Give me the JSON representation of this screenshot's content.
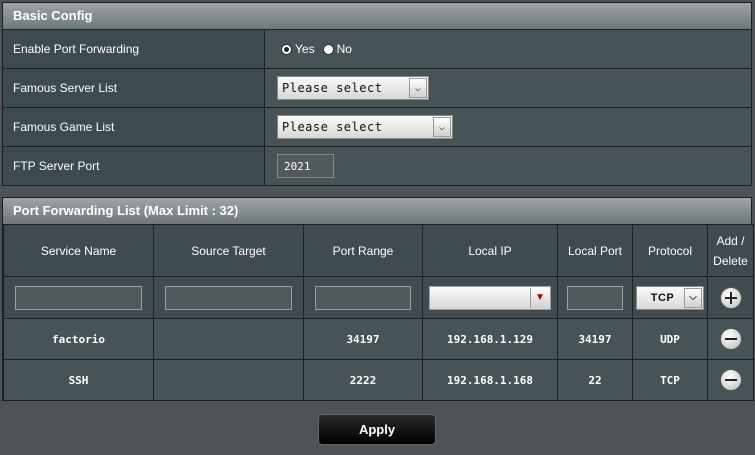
{
  "basic_config": {
    "title": "Basic Config",
    "rows": [
      {
        "label": "Enable Port Forwarding",
        "yes": "Yes",
        "no": "No"
      },
      {
        "label": "Famous Server List",
        "select": "Please select"
      },
      {
        "label": "Famous Game List",
        "select": "Please select"
      },
      {
        "label": "FTP Server Port",
        "value": "2021"
      }
    ]
  },
  "port_forwarding": {
    "title": "Port Forwarding List (Max Limit : 32)",
    "columns": [
      "Service Name",
      "Source Target",
      "Port Range",
      "Local IP",
      "Local Port",
      "Protocol",
      "Add / Delete"
    ],
    "input_protocol": "TCP",
    "rows": [
      {
        "service": "factorio",
        "source": "",
        "port_range": "34197",
        "local_ip": "192.168.1.129",
        "local_port": "34197",
        "protocol": "UDP"
      },
      {
        "service": "SSH",
        "source": "",
        "port_range": "2222",
        "local_ip": "192.168.1.168",
        "local_port": "22",
        "protocol": "TCP"
      }
    ]
  },
  "apply_label": "Apply",
  "icons": {
    "add": "plus-circle-icon",
    "delete": "minus-circle-icon",
    "dropdown": "chevron-down-icon"
  }
}
